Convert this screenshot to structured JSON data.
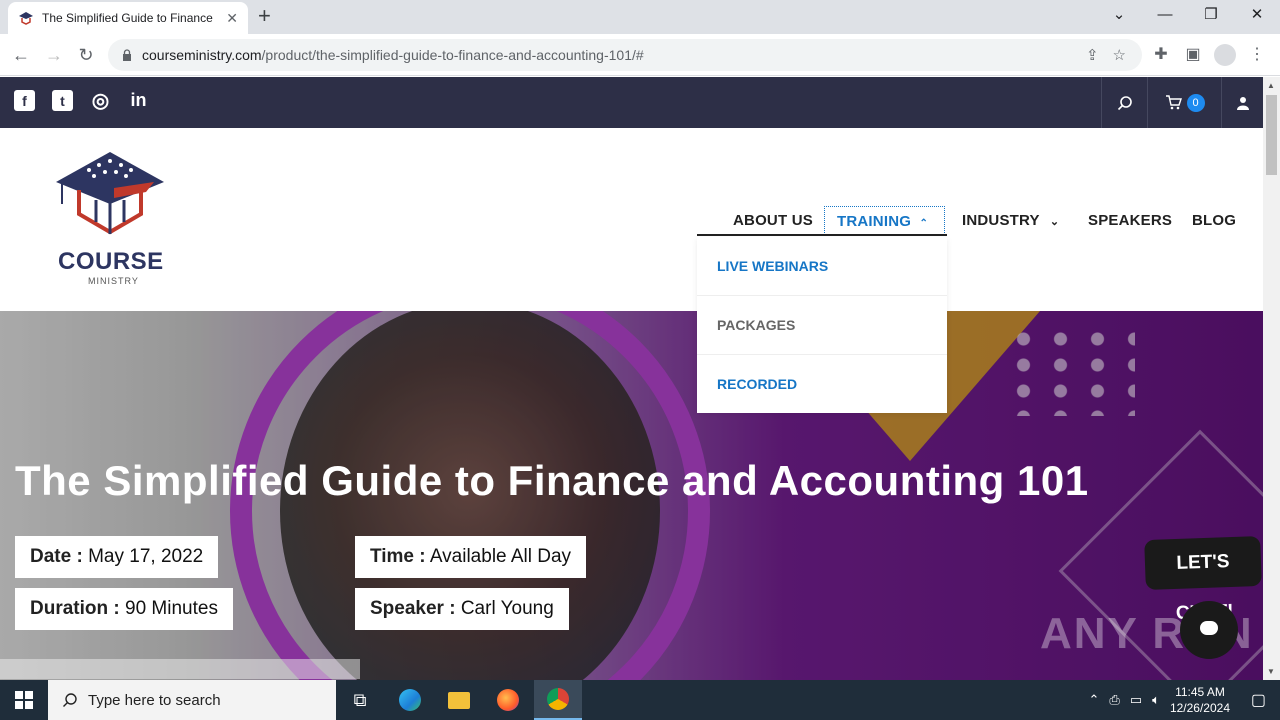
{
  "browser": {
    "tab_title": "The Simplified Guide to Finance",
    "tab_close": "✕",
    "new_tab": "+",
    "window_controls": [
      "⌄",
      "—",
      "❐",
      "✕"
    ],
    "url_host": "courseministry.com",
    "url_path": "/product/the-simplified-guide-to-finance-and-accounting-101/#",
    "nav": {
      "back": "←",
      "forward": "→",
      "reload": "↻"
    }
  },
  "site": {
    "social_icons": [
      "facebook-icon",
      "twitter-icon",
      "instagram-icon",
      "linkedin-icon"
    ],
    "social_glyphs": [
      "f",
      "t",
      "◎",
      "in"
    ],
    "cart_count": "0",
    "logo_text": "COURSE",
    "logo_sub": "MINISTRY",
    "menu": {
      "about": "ABOUT US",
      "training": "TRAINING",
      "industry": "INDUSTRY",
      "speakers": "SPEAKERS",
      "blog": "BLOG"
    },
    "dropdown": [
      {
        "label": "LIVE WEBINARS",
        "color": "#1676c6"
      },
      {
        "label": "PACKAGES",
        "color": "#666666"
      },
      {
        "label": "RECORDED",
        "color": "#1676c6"
      }
    ]
  },
  "hero": {
    "title": "The Simplified Guide to Finance and Accounting 101",
    "date_label": "Date :",
    "date_value": "May 17, 2022",
    "time_label": "Time :",
    "time_value": "Available All Day",
    "duration_label": "Duration :",
    "duration_value": "90 Minutes",
    "speaker_label": "Speaker :",
    "speaker_value": "Carl Young",
    "chat_label": "LET'S CHAT!",
    "watermark": "ANY RUN"
  },
  "taskbar": {
    "search_placeholder": "Type here to search",
    "time": "11:45 AM",
    "date": "12/26/2024"
  },
  "colors": {
    "topbar": "#2d2f47",
    "accent": "#1676c6",
    "hero_purple": "#6b1d86"
  }
}
